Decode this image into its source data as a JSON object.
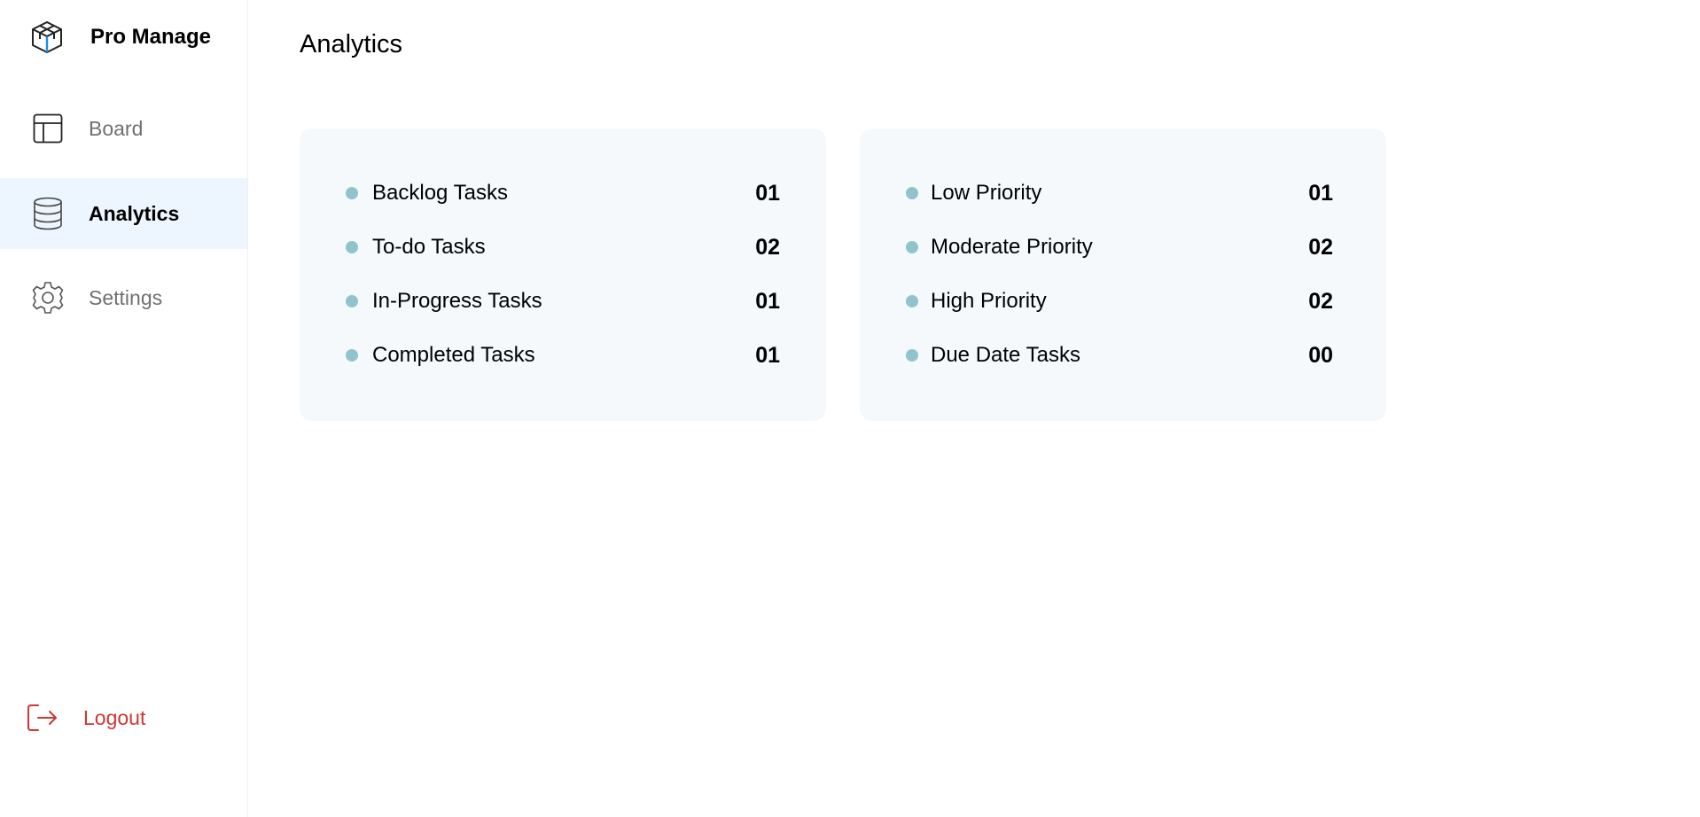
{
  "brand": {
    "name": "Pro Manage"
  },
  "sidebar": {
    "items": [
      {
        "label": "Board",
        "icon": "board-layout-icon"
      },
      {
        "label": "Analytics",
        "icon": "database-icon",
        "active": true
      },
      {
        "label": "Settings",
        "icon": "gear-icon"
      }
    ],
    "logout": {
      "label": "Logout",
      "icon": "logout-icon"
    }
  },
  "main": {
    "title": "Analytics",
    "task_status": [
      {
        "label": "Backlog Tasks",
        "value": "01"
      },
      {
        "label": "To-do Tasks",
        "value": "02"
      },
      {
        "label": "In-Progress Tasks",
        "value": "01"
      },
      {
        "label": "Completed Tasks",
        "value": "01"
      }
    ],
    "priority": [
      {
        "label": "Low Priority",
        "value": "01"
      },
      {
        "label": "Moderate Priority",
        "value": "02"
      },
      {
        "label": "High Priority",
        "value": "02"
      },
      {
        "label": "Due Date Tasks",
        "value": "00"
      }
    ]
  },
  "colors": {
    "active_nav_bg": "#edf5fe",
    "card_bg": "#f5f9fc",
    "bullet": "#90c4cc",
    "logout": "#cf3636",
    "brand_accent": "#1e8fe0"
  }
}
